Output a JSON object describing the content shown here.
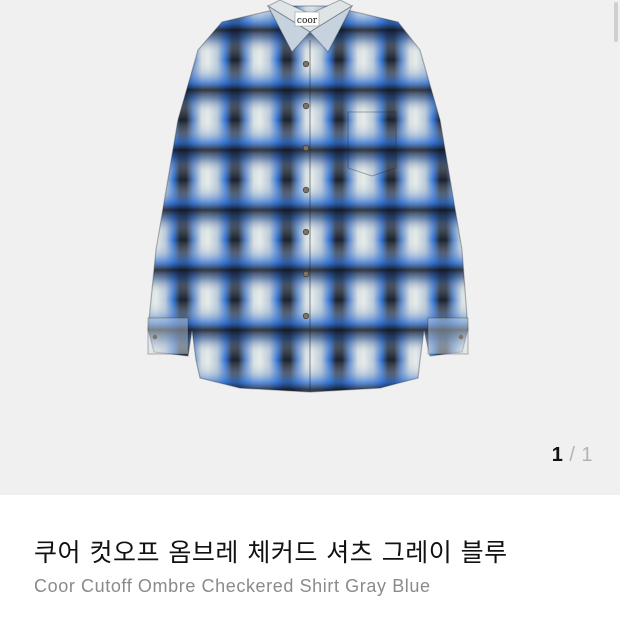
{
  "gallery": {
    "image_alt": "Coor Cutoff Ombre Checkered Shirt Gray Blue",
    "brand_tag": "coor",
    "current_index": "1",
    "separator": "/",
    "total": "1"
  },
  "product": {
    "name_ko": "쿠어 컷오프 옴브레 체커드 셔츠 그레이 블루",
    "name_en": "Coor Cutoff Ombre Checkered Shirt Gray Blue"
  },
  "colors": {
    "background": "#f0f0f0",
    "plaid_dark": "#1c2330",
    "plaid_blue": "#2f6fd0",
    "plaid_light": "#e6ecea"
  }
}
